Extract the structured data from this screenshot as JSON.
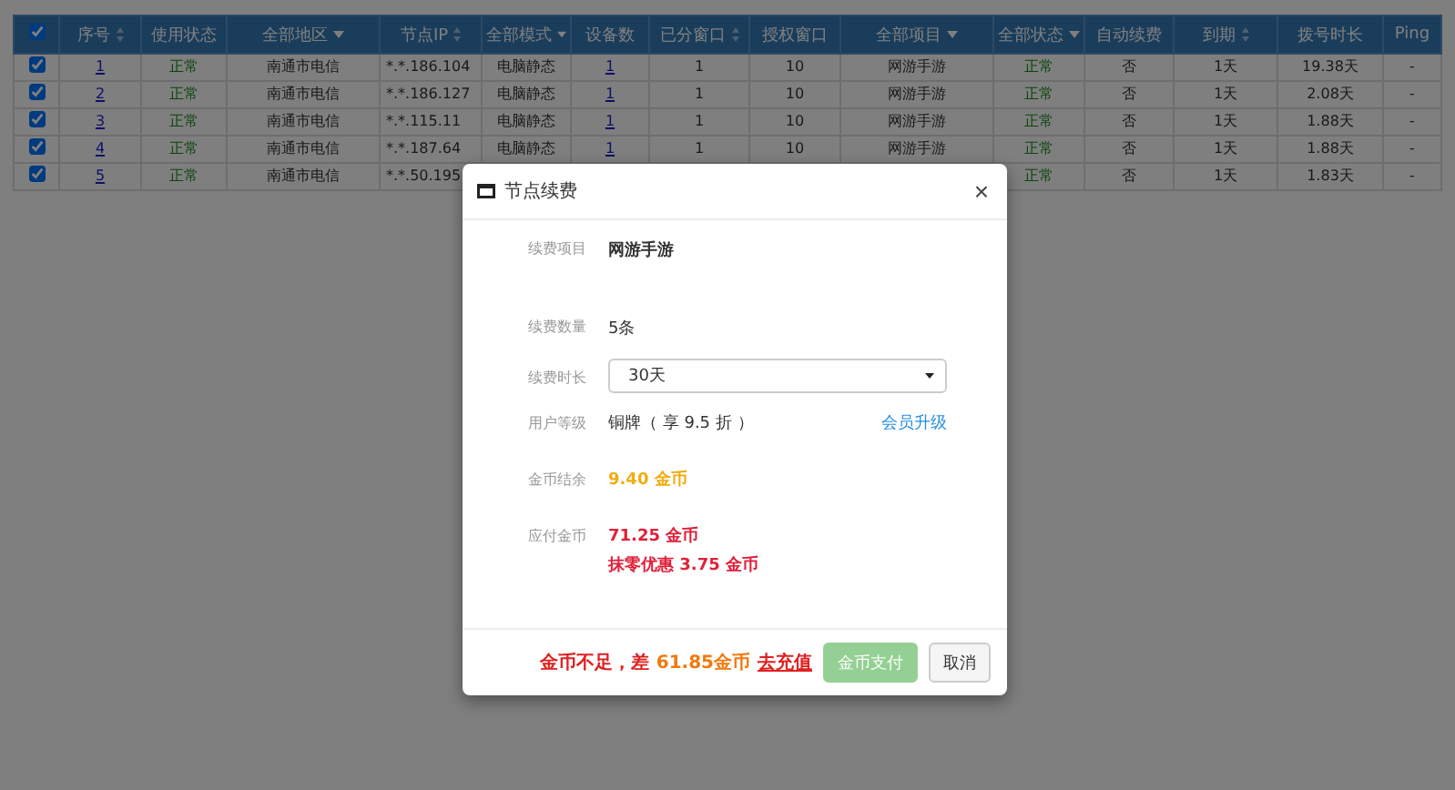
{
  "table": {
    "header_checked": true,
    "columns": [
      {
        "label": "序号",
        "kind": "sort"
      },
      {
        "label": "使用状态",
        "kind": "plain"
      },
      {
        "label": "全部地区",
        "kind": "dropdown"
      },
      {
        "label": "节点IP",
        "kind": "sort"
      },
      {
        "label": "全部模式",
        "kind": "dropdown"
      },
      {
        "label": "设备数",
        "kind": "plain"
      },
      {
        "label": "已分窗口",
        "kind": "sort"
      },
      {
        "label": "授权窗口",
        "kind": "plain"
      },
      {
        "label": "全部项目",
        "kind": "dropdown"
      },
      {
        "label": "全部状态",
        "kind": "dropdown"
      },
      {
        "label": "自动续费",
        "kind": "plain"
      },
      {
        "label": "到期",
        "kind": "sort"
      },
      {
        "label": "拨号时长",
        "kind": "plain"
      },
      {
        "label": "Ping",
        "kind": "plain"
      }
    ],
    "rows": [
      {
        "checked": true,
        "cells": [
          "1",
          "正常",
          "南通市电信",
          "*.*.186.104",
          "电脑静态",
          "1",
          "1",
          "10",
          "网游手游",
          "正常",
          "否",
          "1天",
          "19.38天",
          "-"
        ]
      },
      {
        "checked": true,
        "cells": [
          "2",
          "正常",
          "南通市电信",
          "*.*.186.127",
          "电脑静态",
          "1",
          "1",
          "10",
          "网游手游",
          "正常",
          "否",
          "1天",
          "2.08天",
          "-"
        ]
      },
      {
        "checked": true,
        "cells": [
          "3",
          "正常",
          "南通市电信",
          "*.*.115.11",
          "电脑静态",
          "1",
          "1",
          "10",
          "网游手游",
          "正常",
          "否",
          "1天",
          "1.88天",
          "-"
        ]
      },
      {
        "checked": true,
        "cells": [
          "4",
          "正常",
          "南通市电信",
          "*.*.187.64",
          "电脑静态",
          "1",
          "1",
          "10",
          "网游手游",
          "正常",
          "否",
          "1天",
          "1.88天",
          "-"
        ]
      },
      {
        "checked": true,
        "cells": [
          "5",
          "正常",
          "南通市电信",
          "*.*.50.195",
          null,
          null,
          null,
          null,
          null,
          "正常",
          "否",
          "1天",
          "1.83天",
          "-"
        ]
      }
    ]
  },
  "dialog": {
    "title": "节点续费",
    "close": "×",
    "project_label": "续费项目",
    "project": "网游手游",
    "count_label": "续费数量",
    "count": "5条",
    "duration_label": "续费时长",
    "duration": "30天",
    "level_label": "用户等级",
    "level": "铜牌（ 享 9.5 折 ）",
    "upgrade_link": "会员升级",
    "balance_label": "金币结余",
    "balance": "9.40 金币",
    "payable_label": "应付金币",
    "payable": "71.25 金币",
    "discount": "抹零优惠 3.75 金币",
    "shortfall": "金币不足，差",
    "shortfall_amount": "61.85金币",
    "recharge_link": "去充值",
    "buttons": [
      {
        "label": "金币支付",
        "kind": "primary",
        "disabled": true
      },
      {
        "label": "取消",
        "kind": "default",
        "disabled": false
      }
    ]
  }
}
